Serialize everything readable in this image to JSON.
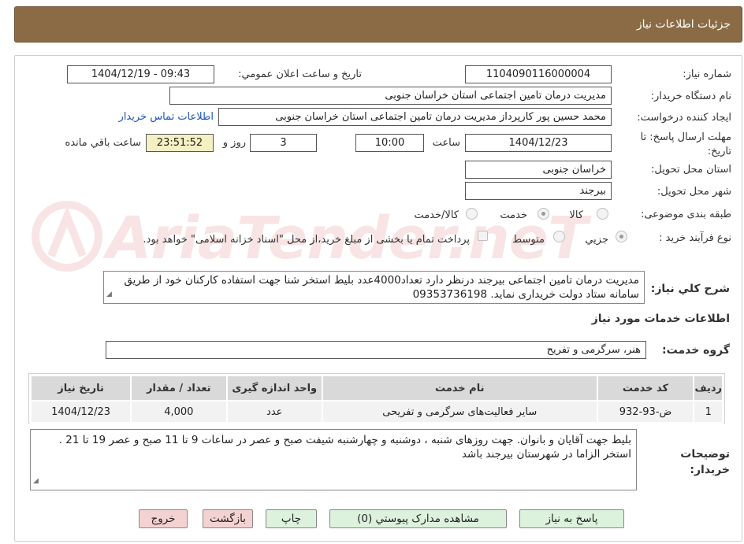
{
  "header": {
    "title": "جزئیات اطلاعات نیاز"
  },
  "fields": {
    "need_number_label": "شماره نیاز:",
    "need_number": "1104090116000004",
    "announce_label": "تاریخ و ساعت اعلان عمومي:",
    "announce_value": "1404/12/19 - 09:43",
    "buyer_org_label": "نام دستگاه خريدار:",
    "buyer_org": "مدیریت درمان تامین اجتماعی استان خراسان جنوبی",
    "requester_label": "ايجاد کننده درخواست:",
    "requester": "محمد حسین پور کارپرداز مدیریت درمان تامین اجتماعی استان خراسان جنوبی",
    "contact_link": "اطلاعات تماس خريدار",
    "deadline_label": "مهلت ارسال پاسخ: تا تاریخ:",
    "deadline_date": "1404/12/23",
    "time_label": "ساعت",
    "deadline_time": "10:00",
    "days_value": "3",
    "days_label": "روز و",
    "remaining_time": "23:51:52",
    "remaining_label": "ساعت باقي مانده",
    "province_label": "استان محل تحويل:",
    "province": "خراسان جنوبی",
    "city_label": "شهر محل تحويل:",
    "city": "بیرجند",
    "category_label": "طبقه بندی موضوعی:",
    "category_options": [
      "کالا",
      "خدمت",
      "کالا/خدمت"
    ],
    "category_selected": "خدمت",
    "process_label": "نوع فرآيند خريد :",
    "process_options": [
      "جزيي",
      "متوسط"
    ],
    "process_selected": "جزيي",
    "payment_note": "پرداخت تمام یا بخشی از مبلغ خرید،از محل \"اسناد خزانه اسلامی\" خواهد بود."
  },
  "description": {
    "label": "شرح کلي نياز:",
    "text": "مدیریت درمان تامین اجتماعی بیرجند درنظر دارد تعداد4000عدد بلیط استخر شنا جهت استفاده کارکنان خود از طریق سامانه ستاد دولت خریداری نماید. 09353736198"
  },
  "services": {
    "section_title": "اطلاعات خدمات مورد نياز",
    "group_label": "گروه خدمت:",
    "group_value": "هنر، سرگرمی و تفریح",
    "columns": [
      "رديف",
      "کد خدمت",
      "نام خدمت",
      "واحد اندازه گيری",
      "تعداد / مقدار",
      "تاريخ نياز"
    ],
    "rows": [
      [
        "1",
        "ض-93-932",
        "سایر فعالیت‌های سرگرمی و تفریحی",
        "عدد",
        "4,000",
        "1404/12/23"
      ]
    ]
  },
  "buyer_notes": {
    "label": "توضيحات خريدار:",
    "text": "بلیط جهت آقایان و بانوان. جهت روزهای شنبه ، دوشنبه و چهارشنبه شیفت صبح و عصر  در ساعات 9 تا 11 صبح و عصر 19 تا 21 . استخر الزاما در شهرستان بیرجند باشد"
  },
  "buttons": {
    "reply": "پاسخ به نياز",
    "documents": "مشاهده مدارک پيوستي (0)",
    "print": "چاپ",
    "back": "بازگشت",
    "exit": "خروج"
  },
  "watermark": {
    "text": "AriaTender.neT"
  },
  "colors": {
    "header_bg": "#8b6b45",
    "button_green": "#ddf2dd",
    "button_pink": "#f5d2d2",
    "link": "#1a57b8"
  }
}
